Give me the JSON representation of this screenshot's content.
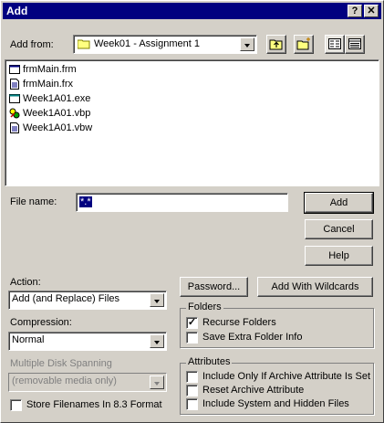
{
  "window": {
    "title": "Add",
    "help_glyph": "?",
    "close_glyph": "✕"
  },
  "add_from": {
    "label": "Add from:",
    "value": "Week01 - Assignment 1"
  },
  "toolbar_icons": [
    "up-folder-icon",
    "new-folder-icon",
    "list-view-icon",
    "details-view-icon"
  ],
  "files": [
    {
      "name": "frmMain.frm",
      "icon": "form-file-icon"
    },
    {
      "name": "frmMain.frx",
      "icon": "document-icon"
    },
    {
      "name": "Week1A01.exe",
      "icon": "exe-icon"
    },
    {
      "name": "Week1A01.vbp",
      "icon": "vb-project-icon"
    },
    {
      "name": "Week1A01.vbw",
      "icon": "document-icon"
    }
  ],
  "file_name": {
    "label": "File name:",
    "value": "*.*"
  },
  "buttons": {
    "add": "Add",
    "cancel": "Cancel",
    "help": "Help",
    "password": "Password...",
    "add_with_wildcards": "Add With Wildcards"
  },
  "action": {
    "label": "Action:",
    "value": "Add (and Replace) Files"
  },
  "compression": {
    "label": "Compression:",
    "value": "Normal"
  },
  "multiple_disk_spanning": {
    "label": "Multiple Disk Spanning",
    "value": "(removable media only)"
  },
  "store_filenames": {
    "label": "Store Filenames In 8.3 Format",
    "checked": false
  },
  "folders": {
    "legend": "Folders",
    "recurse": {
      "label": "Recurse Folders",
      "checked": true
    },
    "save_extra": {
      "label": "Save Extra Folder Info",
      "checked": false
    }
  },
  "attributes": {
    "legend": "Attributes",
    "include_archive": {
      "label": "Include Only If Archive Attribute Is Set",
      "checked": false
    },
    "reset_archive": {
      "label": "Reset Archive Attribute",
      "checked": false
    },
    "include_system": {
      "label": "Include System and Hidden Files",
      "checked": false
    }
  },
  "checkmark_glyph": "✓"
}
